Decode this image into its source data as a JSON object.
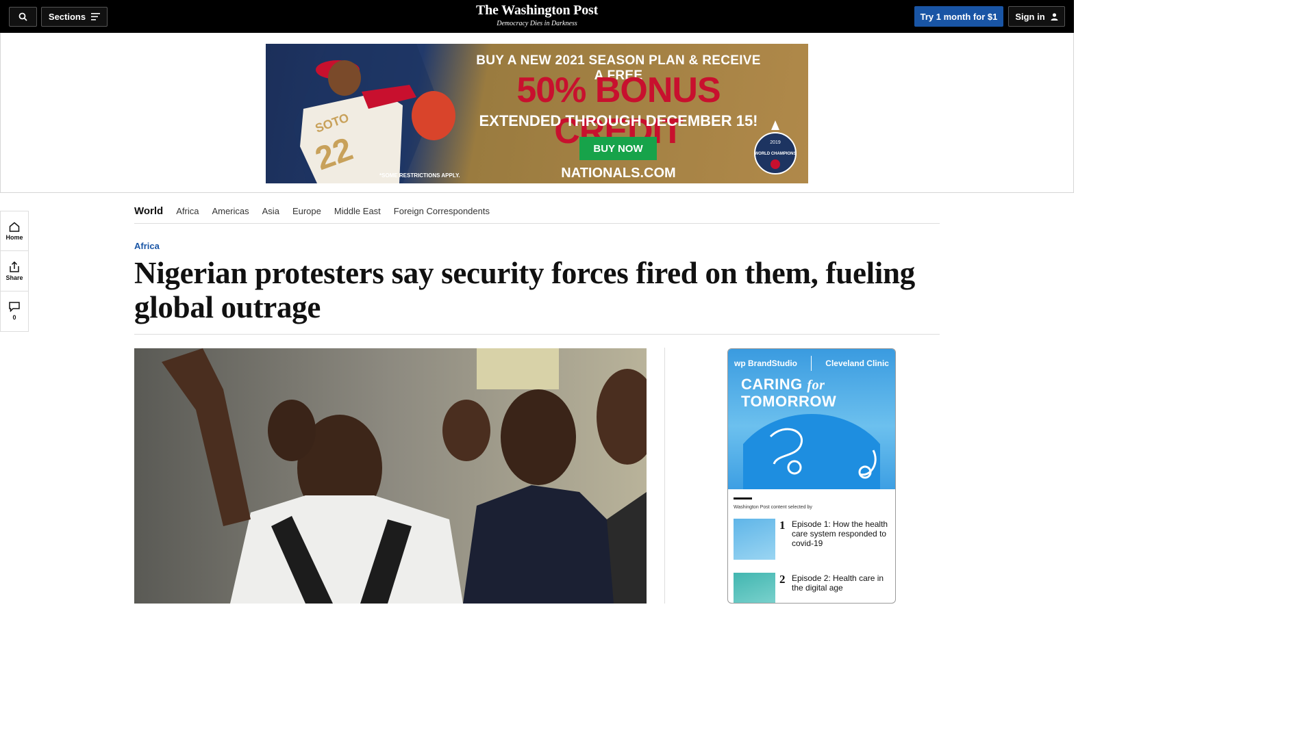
{
  "header": {
    "sections_label": "Sections",
    "logo_name": "The Washington Post",
    "logo_tagline": "Democracy Dies in Darkness",
    "try_label": "Try 1 month for $1",
    "signin_label": "Sign in"
  },
  "ad": {
    "line1": "BUY A NEW 2021 SEASON PLAN & RECEIVE A FREE",
    "line2": "50% BONUS CREDIT",
    "line3": "EXTENDED THROUGH DECEMBER 15!",
    "buy_label": "BUY NOW",
    "site": "NATIONALS.COM",
    "restrictions": "*SOME RESTRICTIONS APPLY.",
    "jersey_name": "SOTO",
    "jersey_number": "22",
    "badge_year": "2019",
    "badge_text": "WORLD CHAMPIONS"
  },
  "section_nav": {
    "items": [
      "World",
      "Africa",
      "Americas",
      "Asia",
      "Europe",
      "Middle East",
      "Foreign Correspondents"
    ]
  },
  "rail": {
    "home_label": "Home",
    "share_label": "Share",
    "comments_count": "0"
  },
  "article": {
    "kicker": "Africa",
    "headline": "Nigerian protesters say security forces fired on them, fueling global outrage"
  },
  "brand_card": {
    "brand_label": "wp BrandStudio",
    "partner_label": "Cleveland Clinic",
    "title_line1_a": "CARING",
    "title_line1_b": "for",
    "title_line2": "TOMORROW",
    "selected_by": "Washington Post content selected by",
    "episodes": [
      {
        "num": "1",
        "title": "Episode 1: How the health care system responded to covid-19"
      },
      {
        "num": "2",
        "title": "Episode 2: Health care in the digital age"
      }
    ]
  },
  "colors": {
    "topbar": "#000000",
    "accent_blue": "#1955a5",
    "ad_red": "#c8102e",
    "ad_green": "#17a34a"
  },
  "icons": [
    "search-icon",
    "menu-icon",
    "user-icon",
    "home-icon",
    "share-icon",
    "comment-icon"
  ]
}
